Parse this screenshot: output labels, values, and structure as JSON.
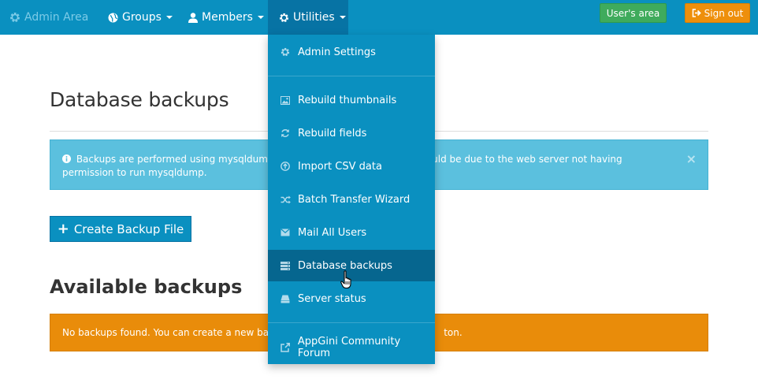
{
  "navbar": {
    "brand": "Admin Area",
    "groups_label": "Groups",
    "members_label": "Members",
    "utilities_label": "Utilities",
    "users_area_label": "User's area",
    "signout_label": "Sign out"
  },
  "main": {
    "title": "Database backups",
    "info_alert_visible_left": "Backups are performed using mysqldump co",
    "info_alert_visible_right": "created, it could be due to the web server not having",
    "info_alert_line2": "permission to run mysqldump.",
    "close_symbol": "×",
    "create_button_label": "Create Backup File",
    "available_title": "Available backups",
    "warn_visible_left": "No backups found. You can create a new backup",
    "warn_visible_right": "ton."
  },
  "utilities_menu": {
    "items": [
      {
        "label": "Admin Settings",
        "icon": "gear-icon"
      },
      {
        "label": "Rebuild thumbnails",
        "icon": "picture-icon"
      },
      {
        "label": "Rebuild fields",
        "icon": "refresh-icon"
      },
      {
        "label": "Import CSV data",
        "icon": "upload-icon"
      },
      {
        "label": "Batch Transfer Wizard",
        "icon": "shuffle-icon"
      },
      {
        "label": "Mail All Users",
        "icon": "envelope-icon"
      },
      {
        "label": "Database backups",
        "icon": "database-icon"
      },
      {
        "label": "Server status",
        "icon": "hdd-icon"
      },
      {
        "label": "AppGini Community Forum",
        "icon": "external-link-icon"
      }
    ],
    "hovered_index": 6
  },
  "colors": {
    "navbar": "#0a90c0",
    "menu_hover": "#06668f",
    "info": "#5bc0de",
    "warning": "#e98c0a",
    "success": "#3fab5c",
    "signout": "#ee8f0b"
  }
}
